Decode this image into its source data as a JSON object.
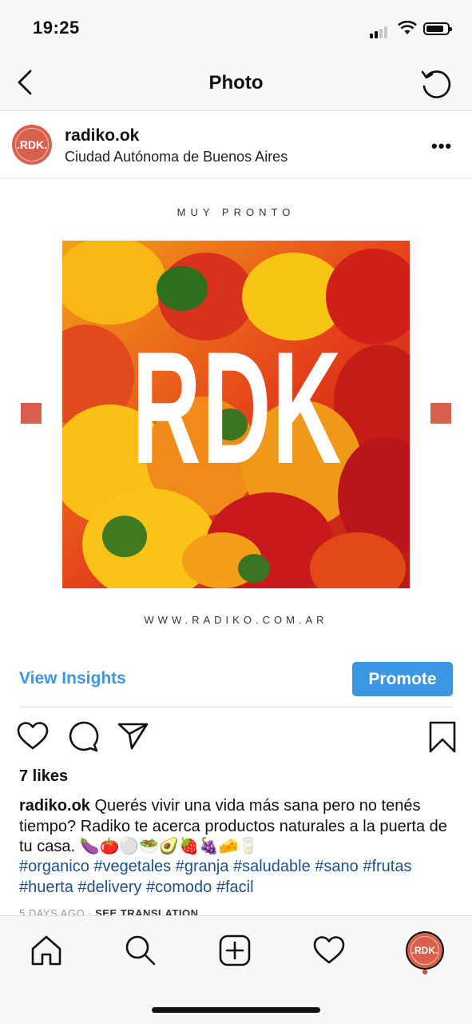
{
  "status_bar": {
    "time": "19:25"
  },
  "header": {
    "title": "Photo"
  },
  "post": {
    "username": "radiko.ok",
    "location": "Ciudad Autónoma de Buenos Aires",
    "avatar_text": ".RDK.",
    "image": {
      "top_text": "MUY PRONTO",
      "logo_text": "RDK",
      "bottom_text": "WWW.RADIKO.COM.AR",
      "accent_color": "#d9604d"
    },
    "view_insights": "View Insights",
    "promote": "Promote",
    "likes": "7 likes",
    "caption_user": "radiko.ok",
    "caption_text": "Querés vivir una vida más sana pero no tenés tiempo? Radiko te acerca productos naturales a la puerta de tu casa. 🍆🍅⚪🥗🥑🍓🍇🧀🥛",
    "hashtags": "#organico #vegetales #granja #saludable #sano #frutas #huerta #delivery #comodo #facil",
    "timestamp": "5 DAYS AGO",
    "translate": "SEE TRANSLATION"
  },
  "tabbar": {
    "avatar_text": ".RDK."
  },
  "colors": {
    "link_blue": "#3b97e3",
    "hashtag_blue": "#1f4f8b",
    "brand": "#d9604d"
  }
}
